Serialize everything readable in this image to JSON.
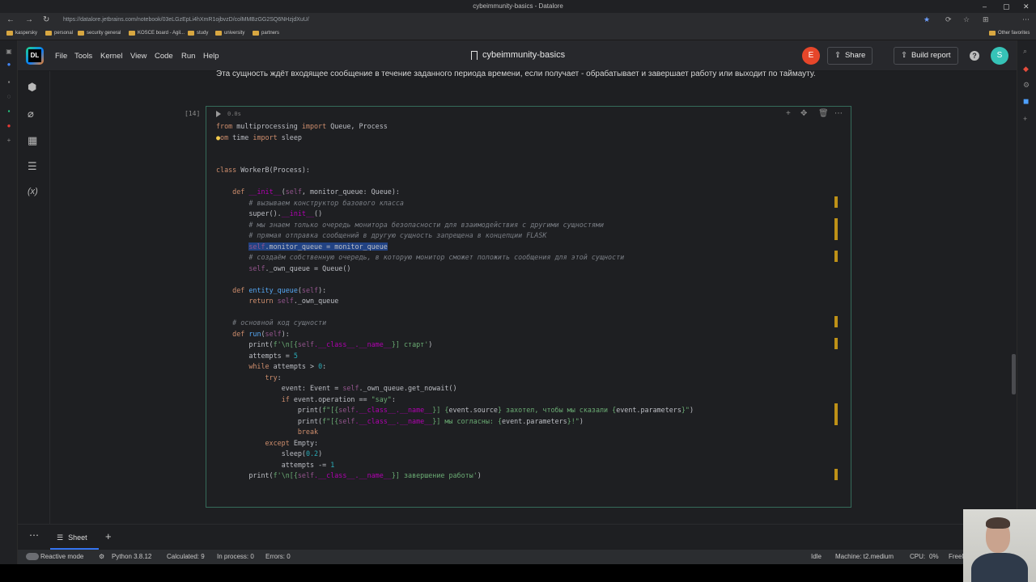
{
  "browser": {
    "window_title": "cybeimmunity-basics - Datalore",
    "url": "https://datalore.jetbrains.com/notebook/03eLGzEpLi4hXmR1ojbvzD/colMMBzGG2SQ6NHzjdXuU/",
    "bookmarks": [
      "kaspersky",
      "personal",
      "security general",
      "KOSCE board - Agil...",
      "study",
      "university",
      "partners"
    ],
    "other_favorites": "Other favorites"
  },
  "header": {
    "menu": [
      "File",
      "Tools",
      "Kernel",
      "View",
      "Code",
      "Run",
      "Help"
    ],
    "notebook_title": "cybeimmunity-basics",
    "user_initial": "E",
    "share_label": "Share",
    "build_report_label": "Build report",
    "help_label": "?",
    "user2_initial": "S",
    "logo_text": "DL"
  },
  "notebook": {
    "markdown_text": "Эта сущность ждёт входящее сообщение в течение заданного периода времени, если получает - обрабатывает и завершает работу или выходит по таймауту.",
    "cell_number": "[14]",
    "exec_time": "0.0s"
  },
  "code": {
    "l1_a": "from",
    "l1_b": " multiprocessing ",
    "l1_c": "import",
    "l1_d": " Queue, Process",
    "l2_a": "om",
    "l2_b": " time ",
    "l2_c": "import",
    "l2_d": " sleep",
    "l5_a": "class",
    "l5_b": " WorkerB(Process):",
    "l7_a": "def",
    "l7_b": "__init__",
    "l7_c": "(",
    "l7_d": "self",
    "l7_e": ", monitor_queue: Queue):",
    "l8": "# вызываем конструктор базового класса",
    "l9_a": "super().",
    "l9_b": "__init__",
    "l9_c": "()",
    "l10": "# мы знаем только очередь монитора безопасности для взаимодействия с другими сущностями",
    "l11": "# прямая отправка сообщений в другую сущность запрещена в концепции FLASK",
    "l12_a": "self",
    "l12_b": ".monitor_queue = monitor_queue",
    "l13": "# создаём собственную очередь, в которую монитор сможет положить сообщения для этой сущности",
    "l14_a": "self",
    "l14_b": "._own_queue = Queue()",
    "l16_a": "def",
    "l16_b": "entity_queue",
    "l16_c": "(",
    "l16_d": "self",
    "l16_e": "):",
    "l17_a": "return",
    "l17_b": "self",
    "l17_c": "._own_queue",
    "l19": "# основной код сущности",
    "l20_a": "def",
    "l20_b": "run",
    "l20_c": "(",
    "l20_d": "self",
    "l20_e": "):",
    "l21_a": "print(",
    "l21_b": "f'\\n[{",
    "l21_c": "self",
    "l21_d": ".__class__.__name__",
    "l21_e": "}] старт'",
    "l21_f": ")",
    "l22_a": "attempts = ",
    "l22_b": "5",
    "l23_a": "while",
    "l23_b": " attempts > ",
    "l23_c": "0",
    "l23_d": ":",
    "l24_a": "try",
    "l24_b": ":",
    "l25_a": "event: Event = ",
    "l25_b": "self",
    "l25_c": "._own_queue.get_nowait()",
    "l26_a": "if",
    "l26_b": " event.operation == ",
    "l26_c": "\"say\"",
    "l26_d": ":",
    "l27_a": "print(",
    "l27_b": "f\"[{",
    "l27_c": "self",
    "l27_d": ".__class__.__name__",
    "l27_e": "}] {",
    "l27_f": "event.source",
    "l27_g": "} захотел, чтобы мы сказали {",
    "l27_h": "event.parameters",
    "l27_i": "}\"",
    "l27_j": ")",
    "l28_a": "print(",
    "l28_b": "f\"[{",
    "l28_c": "self",
    "l28_d": ".__class__.__name__",
    "l28_e": "}] мы согласны: {",
    "l28_f": "event.parameters",
    "l28_g": "}!\"",
    "l28_h": ")",
    "l29": "break",
    "l30_a": "except",
    "l30_b": " Empty:",
    "l31_a": "sleep(",
    "l31_b": "0.2",
    "l31_c": ")",
    "l32_a": "attempts -= ",
    "l32_b": "1",
    "l33_a": "print(",
    "l33_b": "f'\\n[{",
    "l33_c": "self",
    "l33_d": ".__class__.__name__",
    "l33_e": "}] завершение работы'",
    "l33_f": ")"
  },
  "sheets": {
    "tab_label": "Sheet",
    "add_label": "+"
  },
  "status": {
    "reactive_mode": "Reactive mode",
    "python": "Python 3.8.12",
    "calculated": "Calculated: 9",
    "in_process": "In process: 0",
    "errors": "Errors: 0",
    "idle": "Idle",
    "machine": "Machine: t2.medium",
    "cpu_label": "CPU:",
    "cpu_value": "0%",
    "free": "FreeM"
  },
  "colors": {
    "accent": "#3574f0",
    "cell_border": "#356b5a",
    "avatar_e": "#e6462a",
    "avatar_s": "#36c3b7"
  }
}
